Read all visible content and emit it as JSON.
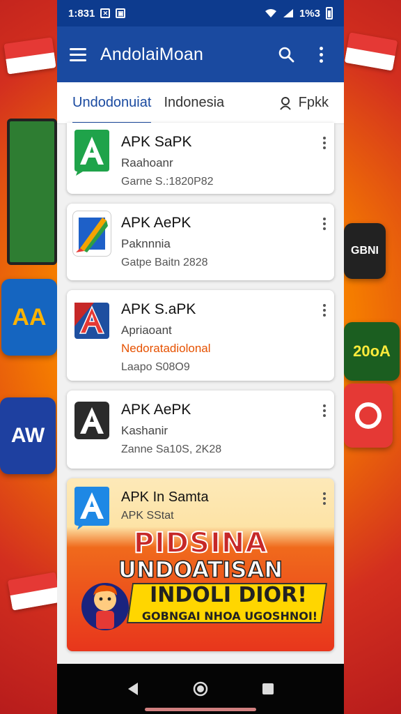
{
  "status_bar": {
    "time": "1:831",
    "battery_text": "1%3"
  },
  "app_bar": {
    "title": "AndolaiMoan",
    "menu_icon": "hamburger-menu-icon",
    "search_icon": "search-icon",
    "overflow_icon": "more-vert-icon"
  },
  "tabs": [
    {
      "label": "Undodonuiat",
      "active": true
    },
    {
      "label": "Indonesia",
      "active": false
    },
    {
      "label": "Fpkk",
      "active": false,
      "icon": "user-icon"
    }
  ],
  "apps": [
    {
      "title": "APK SaPK",
      "subtitle": "Raahoanr",
      "extra": "",
      "meta": "Garne S.:1820P82",
      "icon": "green-a-icon"
    },
    {
      "title": "APK AePK",
      "subtitle": "Paknnnia",
      "extra": "",
      "meta": "Gatpe Baitn 2828",
      "icon": "pencil-stripes-icon"
    },
    {
      "title": "APK S.aPK",
      "subtitle": "Apriaoant",
      "extra": "Nedoratadiolonal",
      "meta": "Laapo S08O9",
      "icon": "red-a-icon"
    },
    {
      "title": "APK AePK",
      "subtitle": "Kashanir",
      "extra": "",
      "meta": "Zanne Sa10S, 2K28",
      "icon": "dark-a-icon"
    }
  ],
  "promo": {
    "title": "APK In Samta",
    "subtitle": "APK SStat",
    "line1": "PIDSINA",
    "line2": "UNDOATISAN",
    "line3": "INDOLI DIOR!",
    "line4": "GOBNGAI NHOA UGOSHNOI!",
    "icon": "blue-a-icon"
  },
  "nav": {
    "back_icon": "back-triangle-icon",
    "home_icon": "home-circle-icon",
    "recents_icon": "recents-square-icon"
  },
  "background_tiles": {
    "t1": "AA",
    "t2": "AW",
    "t3": "GBNI",
    "t4": "20oA"
  },
  "colors": {
    "app_bar": "#1a4aa0",
    "status_bar": "#0d3b8e",
    "accent": "#1a4aa0",
    "highlight_text": "#e65100"
  }
}
